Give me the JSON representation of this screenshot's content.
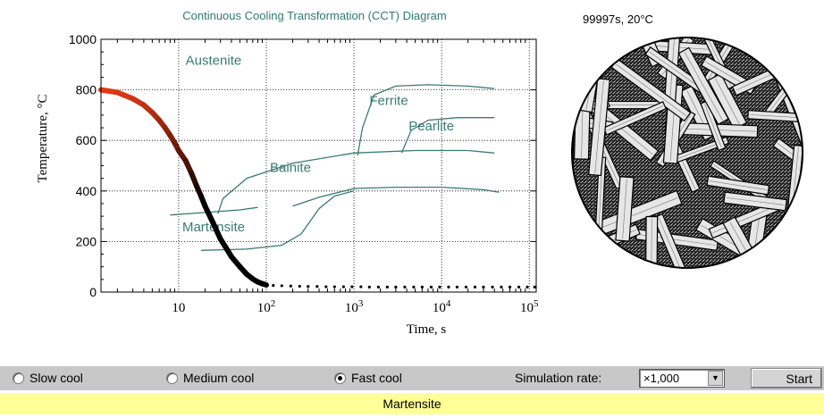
{
  "chart_data": {
    "type": "line",
    "title": "Continuous Cooling Transformation (CCT) Diagram",
    "xlabel": "Time, s",
    "ylabel": "Temperature, °C",
    "xscale": "log",
    "xlim": [
      1.3,
      120000
    ],
    "ylim": [
      0,
      1000
    ],
    "x_ticks": [
      {
        "value": 10,
        "base": "10",
        "exp": ""
      },
      {
        "value": 100,
        "base": "10",
        "exp": "2"
      },
      {
        "value": 1000,
        "base": "10",
        "exp": "3"
      },
      {
        "value": 10000,
        "base": "10",
        "exp": "4"
      },
      {
        "value": 100000,
        "base": "10",
        "exp": "5"
      }
    ],
    "y_ticks": [
      "0",
      "200",
      "400",
      "600",
      "800",
      "1000"
    ],
    "grid": true,
    "region_labels": [
      {
        "text": "Austenite",
        "x": 12,
        "y": 900
      },
      {
        "text": "Ferrite",
        "x": 1500,
        "y": 740
      },
      {
        "text": "Pearlite",
        "x": 4200,
        "y": 640
      },
      {
        "text": "Bainite",
        "x": 110,
        "y": 475
      },
      {
        "text": "Martensite",
        "x": 11,
        "y": 240
      }
    ],
    "curves": [
      {
        "x": [
          1100,
          1250,
          1700,
          3000,
          7000,
          20000,
          40000
        ],
        "y": [
          540,
          650,
          780,
          815,
          820,
          815,
          805
        ]
      },
      {
        "x": [
          3500,
          4500,
          7000,
          15000,
          40000
        ],
        "y": [
          550,
          640,
          680,
          690,
          690
        ]
      },
      {
        "x": [
          28,
          32,
          60,
          200,
          1000,
          5000,
          20000,
          40000
        ],
        "y": [
          310,
          370,
          450,
          510,
          550,
          560,
          560,
          550
        ]
      },
      {
        "x": [
          200,
          400,
          1000,
          3000,
          10000,
          30000,
          45000
        ],
        "y": [
          340,
          375,
          410,
          415,
          415,
          405,
          395
        ]
      },
      {
        "x": [
          8,
          20,
          50,
          80
        ],
        "y": [
          305,
          315,
          325,
          335
        ]
      },
      {
        "x": [
          18,
          60,
          150,
          250,
          400,
          600,
          1000
        ],
        "y": [
          165,
          170,
          185,
          230,
          330,
          380,
          400
        ]
      }
    ],
    "cooling_curve": {
      "x": [
        1.3,
        2,
        3,
        4,
        5,
        6,
        7,
        8,
        9,
        10,
        12,
        14,
        16,
        18,
        20,
        25,
        30,
        40,
        50,
        60,
        70,
        80,
        90,
        100
      ],
      "y": [
        800,
        790,
        765,
        740,
        710,
        680,
        650,
        620,
        590,
        560,
        520,
        470,
        420,
        380,
        340,
        270,
        210,
        140,
        100,
        70,
        52,
        40,
        33,
        28
      ]
    },
    "cooling_dots": {
      "x": [
        120,
        150,
        190,
        240,
        300,
        380,
        480,
        600,
        760,
        950,
        1200,
        1500,
        1900,
        2400,
        3000,
        3800,
        4800,
        6000,
        7600,
        9500,
        12000,
        15000,
        19000,
        24000,
        30000,
        38000,
        48000,
        60000,
        76000,
        95000,
        115000
      ],
      "y": [
        26,
        25,
        24,
        23,
        22,
        22,
        21,
        21,
        21,
        21,
        21,
        20,
        20,
        20,
        20,
        20,
        20,
        20,
        20,
        20,
        20,
        20,
        20,
        20,
        20,
        20,
        20,
        20,
        20,
        20,
        20
      ]
    }
  },
  "timestamp": "99997s, 20°C",
  "controls": {
    "options": [
      {
        "label": "Slow cool",
        "checked": false
      },
      {
        "label": "Medium cool",
        "checked": false
      },
      {
        "label": "Fast cool",
        "checked": true
      }
    ],
    "rate_label": "Simulation rate:",
    "rate_value": "×1,000",
    "start_label": "Start"
  },
  "status": "Martensite",
  "colors": {
    "curve": "#3a7a72",
    "grid": "#000000",
    "status_bg": "#ffff99",
    "control_bg": "#c8c8c8",
    "hot": "#e23a16",
    "cold": "#000000"
  }
}
